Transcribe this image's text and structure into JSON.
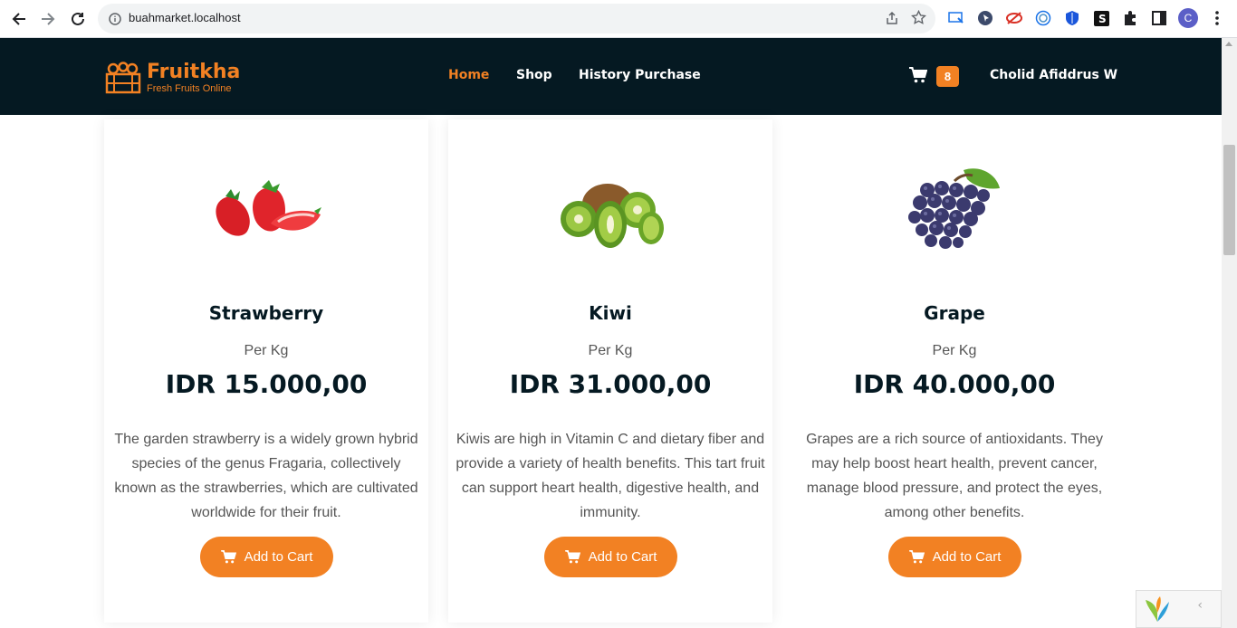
{
  "browser": {
    "url": "buahmarket.localhost",
    "profile_initial": "C"
  },
  "site": {
    "logo_name": "Fruitkha",
    "logo_tagline": "Fresh Fruits Online",
    "nav": [
      {
        "label": "Home",
        "active": true
      },
      {
        "label": "Shop",
        "active": false
      },
      {
        "label": "History Purchase",
        "active": false
      }
    ],
    "cart_count": "8",
    "user_name": "Cholid Afiddrus W",
    "accent_color": "#f28123",
    "header_color": "#051922"
  },
  "products": [
    {
      "name": "Strawberry",
      "unit": "Per Kg",
      "price": "IDR 15.000,00",
      "description": "The garden strawberry is a widely grown hybrid species of the genus Fragaria, collectively known as the strawberries, which are cultivated worldwide for their fruit.",
      "button": "Add to Cart",
      "image": "strawberry-image"
    },
    {
      "name": "Kiwi",
      "unit": "Per Kg",
      "price": "IDR 31.000,00",
      "description": "Kiwis are high in Vitamin C and dietary fiber and provide a variety of health benefits. This tart fruit can support heart health, digestive health, and immunity.",
      "button": "Add to Cart",
      "image": "kiwi-image"
    },
    {
      "name": "Grape",
      "unit": "Per Kg",
      "price": "IDR 40.000,00",
      "description": "Grapes are a rich source of antioxidants. They may help boost heart health, prevent cancer, manage blood pressure, and protect the eyes, among other benefits.",
      "button": "Add to Cart",
      "image": "grape-image"
    }
  ]
}
